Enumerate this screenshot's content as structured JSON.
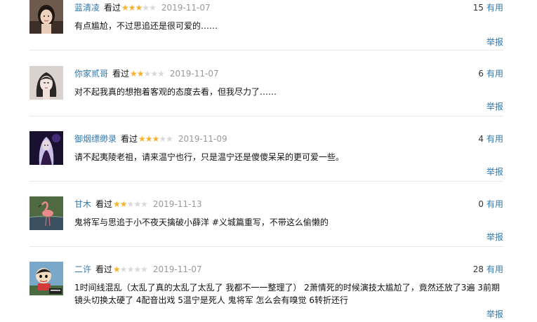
{
  "reviews": [
    {
      "user": "蓝清凌",
      "status": "看过",
      "stars": "★★★★★",
      "rating": 3,
      "date": "2019-11-07",
      "votes": "15",
      "useful_label": "有用",
      "content": "有点尴尬，不过思追还是很可爱的……",
      "report_label": "举报",
      "avatar_icon": "girl-portrait-icon"
    },
    {
      "user": "你家贰哥",
      "status": "看过",
      "stars": "★★★★★",
      "rating": 2,
      "date": "2019-11-07",
      "votes": "6",
      "useful_label": "有用",
      "content": "对不起我真的想抱着客观的态度去看，但我尽力了……",
      "report_label": "举报",
      "avatar_icon": "cartoon-woman-icon"
    },
    {
      "user": "御烟缥缈录",
      "status": "看过",
      "stars": "★★★★★",
      "rating": 3,
      "date": "2019-11-09",
      "votes": "4",
      "useful_label": "有用",
      "content": "请不起夷陵老祖，请来温宁也行，只是温宁还是傻傻呆呆的更可爱一些。",
      "report_label": "举报",
      "avatar_icon": "dark-fantasy-girl-icon"
    },
    {
      "user": "甘木",
      "status": "看过",
      "stars": "★★★★★",
      "rating": 2,
      "date": "2019-11-13",
      "votes": "0",
      "useful_label": "有用",
      "content": "鬼将军与思追于小不夜天擒破小薛洋 #义城篇重写，不带这么偷懒的",
      "report_label": "举报",
      "avatar_icon": "flamingo-icon"
    },
    {
      "user": "二许",
      "status": "看过",
      "stars": "★★★★★",
      "rating": 1,
      "date": "2019-11-07",
      "votes": "28",
      "useful_label": "有用",
      "content": "1时间线混乱（太乱了真的太乱了太乱了 我都不一一整理了） 2萧情死的时候演技太尴尬了，竟然还放了3遍 3前期镜头切换太硬了 4配音出戏 5温宁是死人 鬼将军 怎么会有嗅觉 6转折还行",
      "report_label": "举报",
      "avatar_icon": "crayon-shin-chan-icon"
    }
  ]
}
